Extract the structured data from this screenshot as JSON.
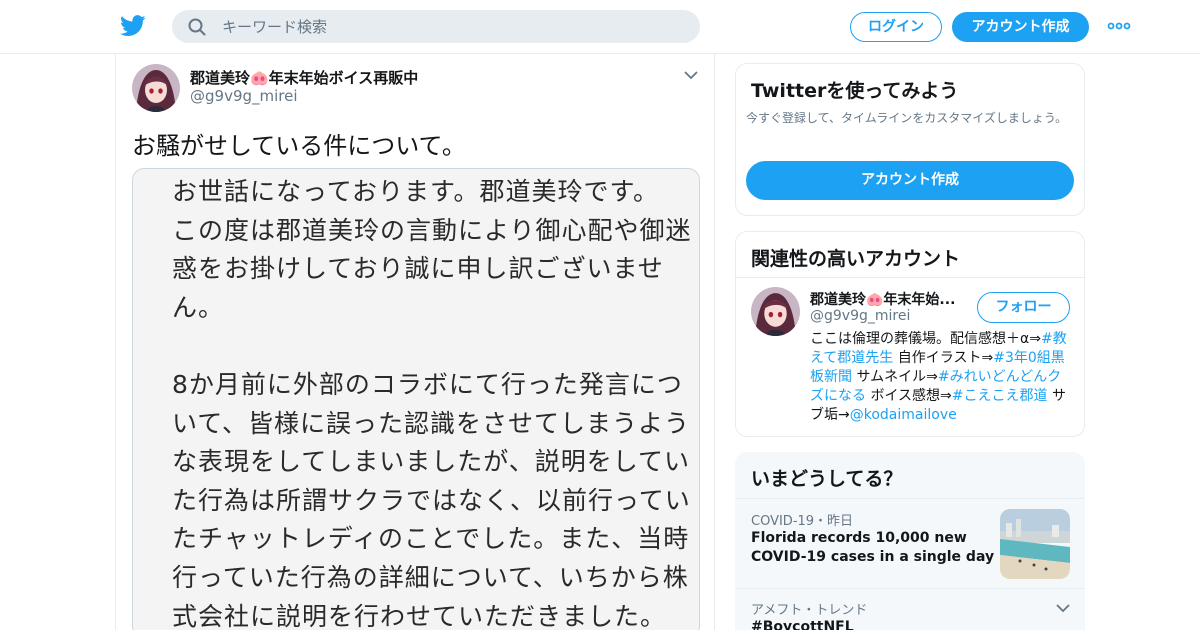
{
  "nav": {
    "search_placeholder": "キーワード検索",
    "login_label": "ログイン",
    "signup_label": "アカウント作成",
    "brand_color": "#1da1f2"
  },
  "tweet": {
    "name": "郡道美玲🐽年末年始ボイス再販中",
    "handle": "@g9v9g_mirei",
    "text": "お騒がせしている件について。",
    "image_lines": [
      "お世話になっております。郡道美玲です。",
      "この度は郡道美玲の言動により御心配や御迷",
      "惑をお掛けしており誠に申し訳ございませ",
      "ん。",
      "",
      "8か月前に外部のコラボにて行った発言につ",
      "いて、皆様に誤った認識をさせてしまうよう",
      "な表現をしてしまいましたが、説明をしてい",
      "た行為は所謂サクラではなく、以前行ってい",
      "たチャットレディのことでした。また、当時",
      "行っていた行為の詳細について、いちから株",
      "式会社に説明を行わせていただきました。"
    ]
  },
  "signup_card": {
    "title": "Twitterを使ってみよう",
    "subtitle": "今すぐ登録して、タイムラインをカスタマイズしましょう。",
    "button": "アカウント作成"
  },
  "related": {
    "title": "関連性の高いアカウント",
    "name": "郡道美玲🐽年末年始...",
    "handle": "@g9v9g_mirei",
    "follow_label": "フォロー",
    "bio": {
      "t1": "ここは倫理の葬儀場。配信感想＋α⇒",
      "tag1": "#教えて郡道先生",
      "t2": " 自作イラスト⇒",
      "tag2": "#3年0組黒板新聞",
      "t3": " サムネイル⇒",
      "tag3": "#みれいどんどんクズになる",
      "t4": " ボイス感想⇒",
      "tag4": "#こえこえ郡道",
      "t5": " サブ垢→",
      "tag5": "@kodaimailove"
    }
  },
  "trends": {
    "title": "いまどうしてる？",
    "items": [
      {
        "meta": "COVID-19・昨日",
        "title": "Florida records 10,000 new COVID-19 cases in a single day"
      },
      {
        "meta": "アメフト・トレンド",
        "title": "#BoycottNFL"
      }
    ]
  }
}
